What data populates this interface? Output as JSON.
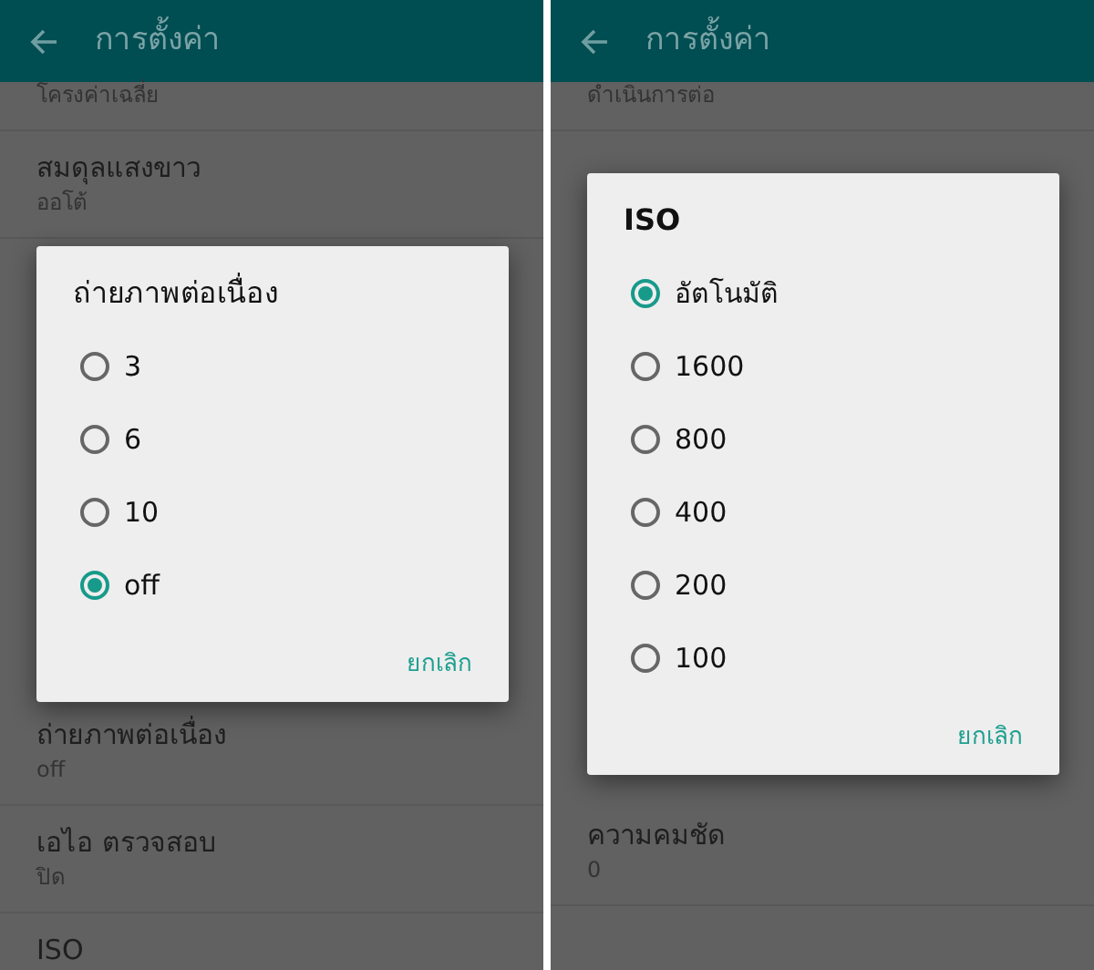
{
  "panels": [
    {
      "header": {
        "title": "การตั้งค่า"
      },
      "items_above": [
        {
          "subtitle": "โครงค่าเฉลี่ย"
        },
        {
          "title": "สมดุลแสงขาว",
          "subtitle": "ออโต้"
        }
      ],
      "items_below": [
        {
          "title": "ถ่ายภาพต่อเนื่อง",
          "subtitle": "off"
        },
        {
          "title": "เอไอ ตรวจสอบ",
          "subtitle": "ปิด"
        },
        {
          "title": "ISO"
        }
      ],
      "dialog": {
        "title": "ถ่ายภาพต่อเนื่อง",
        "options": [
          {
            "label": "3",
            "selected": false
          },
          {
            "label": "6",
            "selected": false
          },
          {
            "label": "10",
            "selected": false
          },
          {
            "label": "off",
            "selected": true
          }
        ],
        "cancel": "ยกเลิก"
      }
    },
    {
      "header": {
        "title": "การตั้งค่า"
      },
      "items_above": [
        {
          "subtitle": "ดำเนินการต่อ"
        }
      ],
      "items_below": [
        {
          "title": "ความคมชัด",
          "subtitle": "0"
        }
      ],
      "dialog": {
        "title": "ISO",
        "options": [
          {
            "label": "อัตโนมัติ",
            "selected": true
          },
          {
            "label": "1600",
            "selected": false
          },
          {
            "label": "800",
            "selected": false
          },
          {
            "label": "400",
            "selected": false
          },
          {
            "label": "200",
            "selected": false
          },
          {
            "label": "100",
            "selected": false
          }
        ],
        "cancel": "ยกเลิก"
      }
    }
  ]
}
